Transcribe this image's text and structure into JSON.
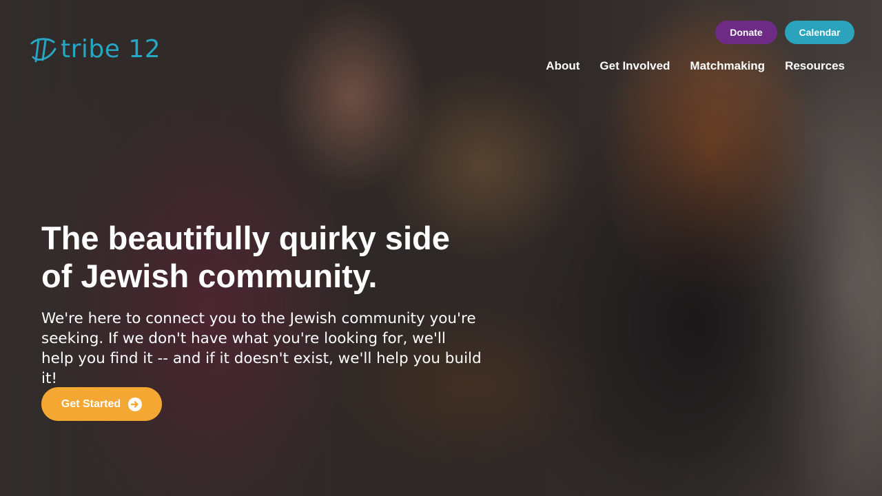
{
  "brand": {
    "name": "tribe 12",
    "logo_icon": "tribe12-logo-mark",
    "color": "#27a6c4"
  },
  "header": {
    "donate_label": "Donate",
    "calendar_label": "Calendar",
    "donate_color": "#6e2b86",
    "calendar_color": "#2ba3bd"
  },
  "nav": {
    "items": [
      {
        "label": "About"
      },
      {
        "label": "Get Involved"
      },
      {
        "label": "Matchmaking"
      },
      {
        "label": "Resources"
      }
    ]
  },
  "hero": {
    "headline_line1": "The beautifully quirky side",
    "headline_line2": "of Jewish community.",
    "subtext": "We're here to connect you to the Jewish community you're seeking. If we don't have what you're looking for, we'll help you find it -- and if it doesn't exist, we'll help you build it!",
    "cta_label": "Get Started",
    "cta_icon": "arrow-right-circle-icon",
    "cta_color": "#f4a833",
    "background_image": "photo-of-two-people-talking-at-event"
  }
}
